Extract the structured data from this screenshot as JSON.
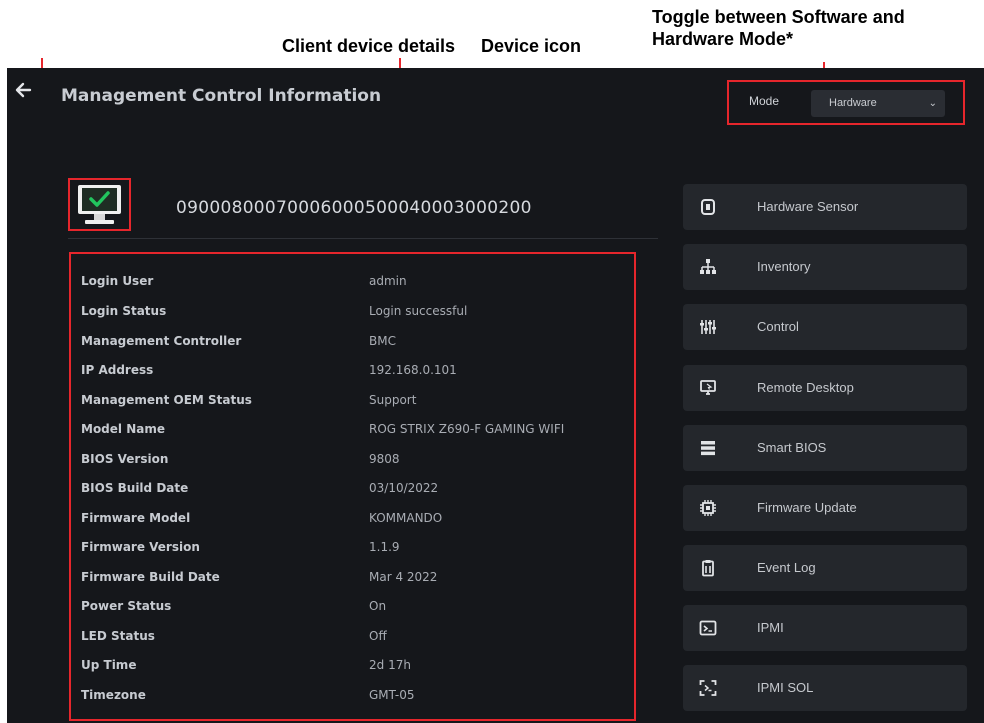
{
  "callouts": {
    "mode": "Toggle between Software and\nHardware Mode*",
    "details": "Client device details",
    "icon": "Device icon"
  },
  "header": {
    "title": "Management Control Information",
    "mode_label": "Mode",
    "mode_value": "Hardware"
  },
  "device": {
    "id": "09000800070006000500040003000200"
  },
  "details": [
    {
      "label": "Login User",
      "value": "admin"
    },
    {
      "label": "Login Status",
      "value": "Login successful"
    },
    {
      "label": "Management Controller",
      "value": "BMC"
    },
    {
      "label": "IP Address",
      "value": "192.168.0.101"
    },
    {
      "label": "Management OEM Status",
      "value": "Support"
    },
    {
      "label": "Model Name",
      "value": "ROG STRIX Z690-F GAMING WIFI"
    },
    {
      "label": "BIOS Version",
      "value": "9808"
    },
    {
      "label": "BIOS Build Date",
      "value": "03/10/2022"
    },
    {
      "label": "Firmware Model",
      "value": "KOMMANDO"
    },
    {
      "label": "Firmware Version",
      "value": "1.1.9"
    },
    {
      "label": "Firmware Build Date",
      "value": "Mar 4 2022"
    },
    {
      "label": "Power Status",
      "value": "On"
    },
    {
      "label": "LED Status",
      "value": "Off"
    },
    {
      "label": "Up Time",
      "value": "2d 17h"
    },
    {
      "label": "Timezone",
      "value": "GMT-05"
    }
  ],
  "menu": [
    {
      "label": "Hardware Sensor",
      "icon": "sensor-icon"
    },
    {
      "label": "Inventory",
      "icon": "inventory-icon"
    },
    {
      "label": "Control",
      "icon": "sliders-icon"
    },
    {
      "label": "Remote Desktop",
      "icon": "remote-desktop-icon"
    },
    {
      "label": "Smart BIOS",
      "icon": "bios-icon"
    },
    {
      "label": "Firmware Update",
      "icon": "chip-icon"
    },
    {
      "label": "Event Log",
      "icon": "clipboard-icon"
    },
    {
      "label": "IPMI",
      "icon": "terminal-icon"
    },
    {
      "label": "IPMI SOL",
      "icon": "scan-terminal-icon"
    }
  ],
  "colors": {
    "background": "#15171b",
    "panel": "#24272c",
    "annotation": "#e6262c",
    "status_ok": "#22c55e"
  }
}
